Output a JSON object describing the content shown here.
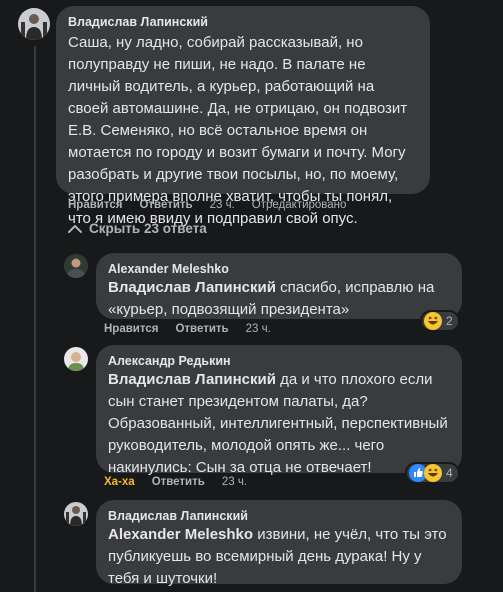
{
  "comments": [
    {
      "author": "Владислав Лапинский",
      "text": "Саша, ну ладно, собирай рассказывай, но полуправду не пиши, не надо. В палате не личный водитель, а курьер, работающий на своей автомашине. Да, не отрицаю, он подвозит Е.В. Семеняко, но всё остальное время он мотается по городу и возит бумаги и почту. Могу разобрать и другие твои посылы, но, по моему, этого примера вполне хватит, чтобы ты понял, что я имею ввиду и подправил свой опус.",
      "like": "Нравится",
      "reply": "Ответить",
      "time": "23 ч.",
      "edited": "Отредактировано"
    }
  ],
  "hide_replies_label": "Скрыть 23 ответа",
  "replies": [
    {
      "author": "Alexander Meleshko",
      "mention": "Владислав Лапинский",
      "text": " спасибо, исправлю на «курьер, подвозящий президента»",
      "like": "Нравится",
      "reply": "Ответить",
      "time": "23 ч.",
      "reaction_count": "2",
      "reaction_types": [
        "haha-icon"
      ]
    },
    {
      "author": "Александр Редькин",
      "mention": "Владислав Лапинский",
      "text": " да и что плохого если сын станет президентом палаты, да? Образованный, интеллигентный, перспективный руководитель, молодой опять же... чего накинулись: Сын за отца не отвечает!",
      "like": "Ха-ха",
      "like_color": "#f7b928",
      "reply": "Ответить",
      "time": "23 ч.",
      "reaction_count": "4",
      "reaction_types": [
        "like-icon",
        "haha-icon"
      ]
    },
    {
      "author": "Владислав Лапинский",
      "mention": "Alexander Meleshko",
      "text": " извини, не учёл, что ты это публикуешь во всемирный день дурака! Ну у тебя и шуточки!"
    }
  ],
  "colors": {
    "background": "#18191a",
    "bubble": "#3a3b3c",
    "text": "#e4e6eb",
    "secondary": "#b0b3b8",
    "haha": "#f7b928",
    "like": "#2e89ff"
  }
}
